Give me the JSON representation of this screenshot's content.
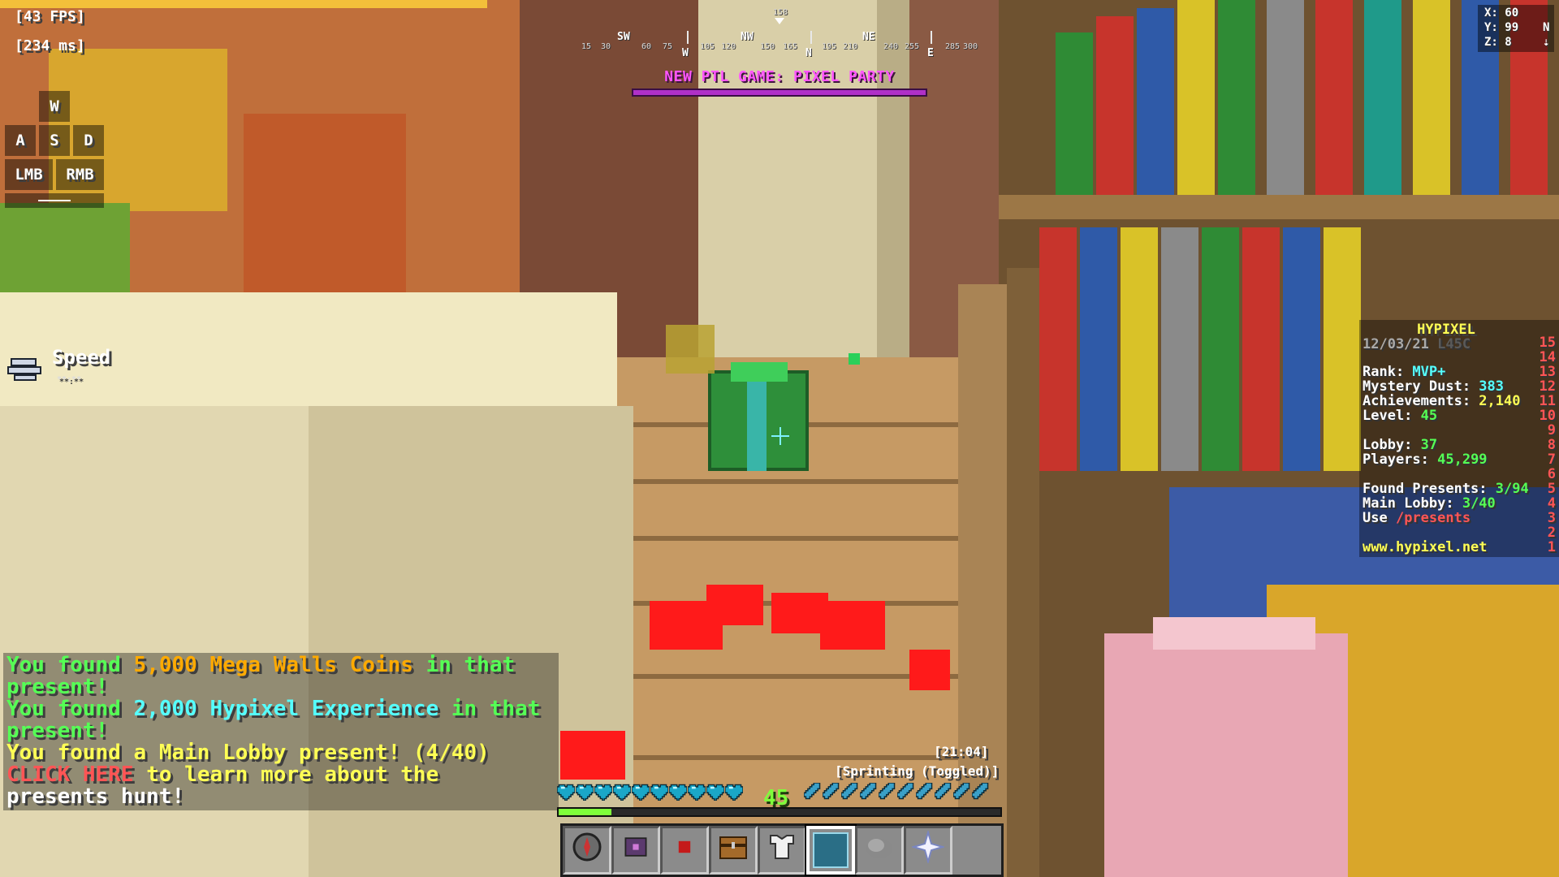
{
  "hud": {
    "fps": "[43 FPS]",
    "ping": "[234 ms]"
  },
  "keystrokes": {
    "w": "W",
    "a": "A",
    "s": "S",
    "d": "D",
    "lmb": "LMB",
    "rmb": "RMB"
  },
  "compass": {
    "heading": "158",
    "degrees": [
      "15",
      "30",
      "60",
      "75",
      "105",
      "120",
      "150",
      "165",
      "195",
      "210",
      "240",
      "255",
      "285",
      "300"
    ],
    "directions": [
      "SW",
      "W",
      "NW",
      "N",
      "NE",
      "E"
    ]
  },
  "bossbar": {
    "title": "NEW PTL GAME: PIXEL PARTY",
    "progress": 1.0,
    "color": "#b030c8"
  },
  "coords": {
    "x": "X: 60",
    "y": "Y: 99",
    "z": "Z: 8",
    "facing": "N",
    "arrow": "⇣"
  },
  "effect": {
    "name": "Speed",
    "duration": "**:**",
    "icon": "speed-icon"
  },
  "scoreboard": {
    "title": "HYPIXEL",
    "date": "12/03/21",
    "server": "L45C",
    "rank_label": "Rank: ",
    "rank_value": "MVP+",
    "dust_label": "Mystery Dust: ",
    "dust_value": "383",
    "ach_label": "Achievements: ",
    "ach_value": "2,140",
    "level_label": "Level: ",
    "level_value": "45",
    "lobby_label": "Lobby: ",
    "lobby_value": "37",
    "players_label": "Players: ",
    "players_value": "45,299",
    "found_label": "Found Presents: ",
    "found_value": "3/94",
    "main_label": "Main Lobby: ",
    "main_value": "3/40",
    "use_label": "Use ",
    "use_value": "/presents",
    "website": "www.hypixel.net",
    "scores": [
      "15",
      "14",
      "13",
      "12",
      "11",
      "10",
      "9",
      "8",
      "7",
      "6",
      "5",
      "4",
      "3",
      "2",
      "1"
    ]
  },
  "chat": {
    "l1a": "You found ",
    "l1b": "5,000 Mega Walls Coins",
    "l1c": " in that",
    "l2": " present!",
    "l3a": "You found ",
    "l3b": "2,000 Hypixel Experience",
    "l3c": " in that",
    "l4": " present!",
    "l5": "You found a Main Lobby present! (4/40)",
    "l6a": "CLICK HERE",
    "l6b": " to learn more about the",
    "l7": " presents hunt!"
  },
  "status": {
    "time": "[21:04]",
    "sprint": "[Sprinting (Toggled)]"
  },
  "player": {
    "level": "45",
    "hearts": 10,
    "food": 10,
    "xp_progress": 0.12
  },
  "hotbar": {
    "selected": 5,
    "items": [
      "compass-icon",
      "shulker-icon",
      "redstone-icon",
      "chest-icon",
      "armor-icon",
      "selected-empty-slot",
      "cobweb-icon",
      "nether-star-icon"
    ]
  }
}
